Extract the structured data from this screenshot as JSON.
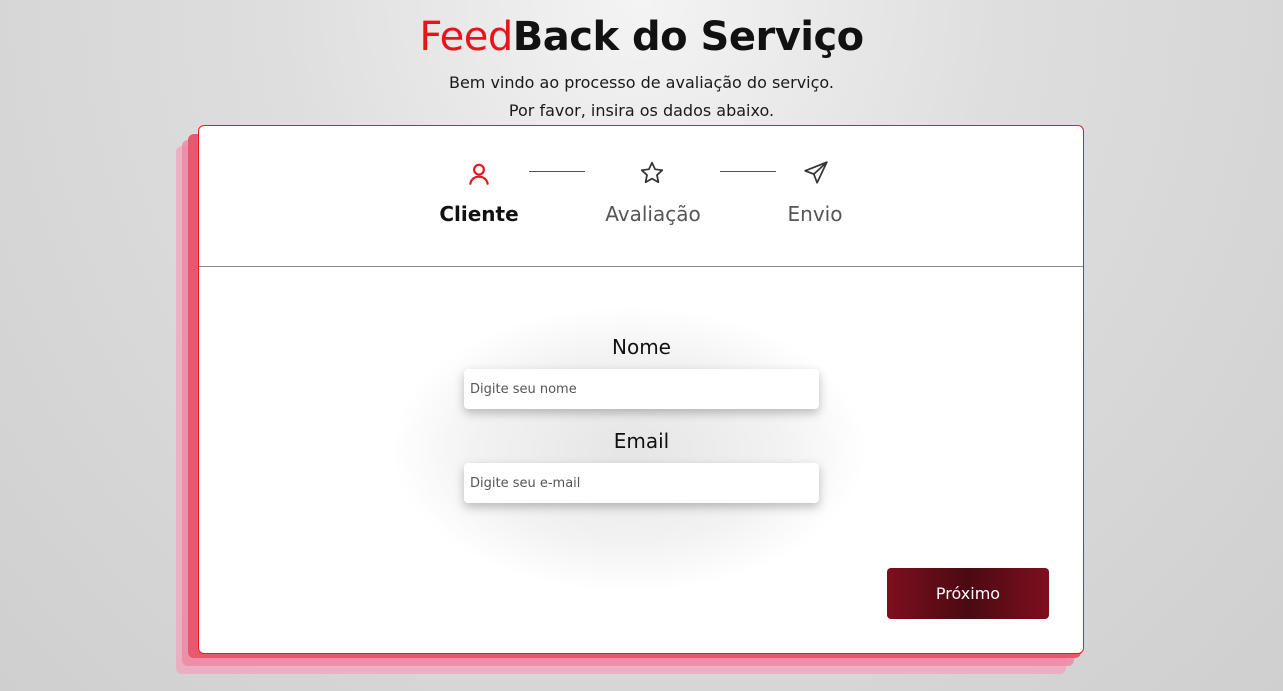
{
  "header": {
    "title_accent": "Feed",
    "title_rest": "Back do Serviço",
    "subtitle_line1": "Bem vindo ao processo de avaliação do serviço.",
    "subtitle_line2": "Por favor, insira os dados abaixo."
  },
  "steps": [
    {
      "label": "Cliente",
      "icon": "user-icon",
      "active": true
    },
    {
      "label": "Avaliação",
      "icon": "star-icon",
      "active": false
    },
    {
      "label": "Envio",
      "icon": "send-icon",
      "active": false
    }
  ],
  "form": {
    "name_label": "Nome",
    "name_placeholder": "Digite seu nome",
    "email_label": "Email",
    "email_placeholder": "Digite seu e-mail",
    "next_label": "Próximo"
  },
  "colors": {
    "accent": "#e8141b",
    "button": "#6b0d1a"
  }
}
